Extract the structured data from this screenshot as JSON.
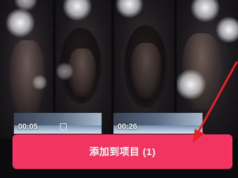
{
  "clips": [
    {
      "duration": "00:05"
    },
    {
      "duration": "00:26"
    }
  ],
  "add_button": {
    "label": "添加到项目 (1)"
  },
  "colors": {
    "accent": "#f23460",
    "annotation_arrow": "#e8202a"
  },
  "icons": [
    "annotation-arrow-icon"
  ]
}
